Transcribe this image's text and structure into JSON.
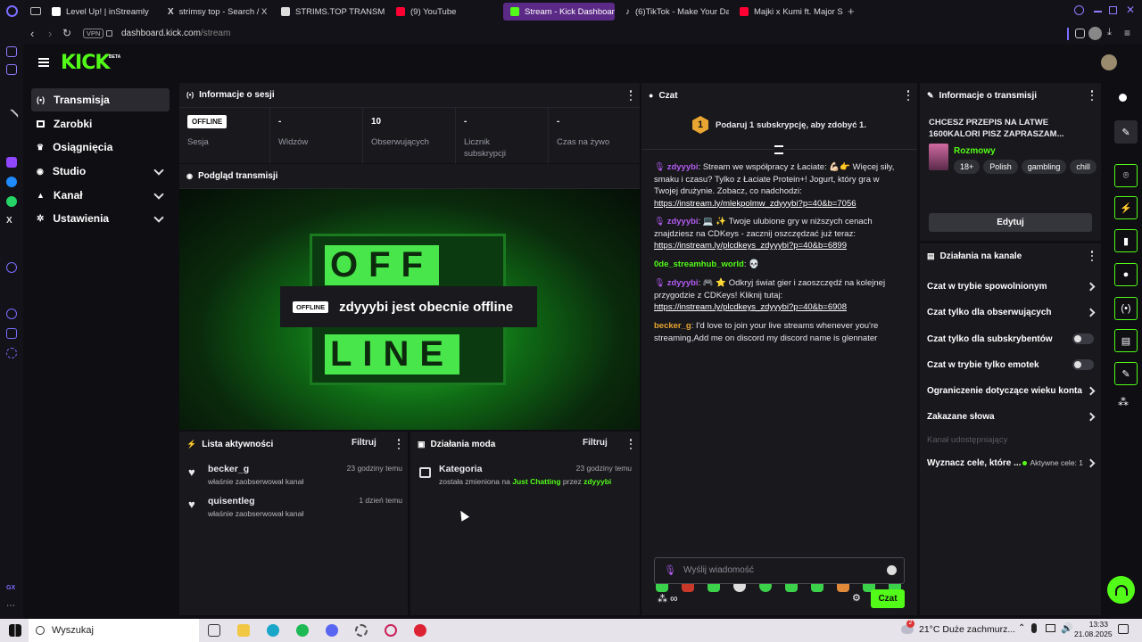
{
  "browser": {
    "tabs": [
      {
        "label": "Level Up! | inStreamly",
        "color": "#ffffff"
      },
      {
        "label": "strimsy top - Search / X",
        "color": "#cccccc"
      },
      {
        "label": "STRIMS.TOP TRANSM",
        "color": "#ffffff"
      },
      {
        "label": "(9) YouTube",
        "color": "#ff0033"
      },
      {
        "label": "Stream - Kick Dashboard",
        "color": "#53fc18"
      },
      {
        "label": "(6)TikTok - Make Your Da",
        "color": "#25f4ee"
      },
      {
        "label": "Majki x Kumi ft. Major SP",
        "color": "#ff0033"
      }
    ],
    "vpn": "VPN",
    "url_host": "dashboard.kick.com",
    "url_path": "/stream"
  },
  "kick": {
    "logo": "KICK",
    "beta": "BETA",
    "nav": [
      {
        "label": "Transmisja",
        "icon": "broadcast-icon"
      },
      {
        "label": "Zarobki",
        "icon": "wallet-icon"
      },
      {
        "label": "Osiągnięcia",
        "icon": "trophy-icon"
      },
      {
        "label": "Studio",
        "icon": "camera-icon"
      },
      {
        "label": "Kanał",
        "icon": "user-icon"
      },
      {
        "label": "Ustawienia",
        "icon": "gear-icon"
      }
    ],
    "session": {
      "title": "Informacje o sesji",
      "badge": "OFFLINE",
      "stats": [
        {
          "value": "",
          "label": "Sesja"
        },
        {
          "value": "-",
          "label": "Widzów"
        },
        {
          "value": "10",
          "label": "Obserwujących"
        },
        {
          "value": "-",
          "label": "Licznik subskrypcji"
        },
        {
          "value": "-",
          "label": "Czas na żywo"
        }
      ]
    },
    "preview": {
      "title": "Podgląd transmisji",
      "badge": "OFFLINE",
      "message": "zdyyybi jest obecnie offline",
      "sign_top": "OFF",
      "sign_bottom": "LINE"
    },
    "activity": {
      "title": "Lista aktywności",
      "filter": "Filtruj",
      "items": [
        {
          "name": "becker_g",
          "action": "właśnie zaobserwował kanał",
          "time": "23 godziny temu"
        },
        {
          "name": "quisentleg",
          "action": "właśnie zaobserwował kanał",
          "time": "1 dzień temu"
        }
      ]
    },
    "mod": {
      "title": "Działania moda",
      "filter": "Filtruj",
      "item": {
        "title": "Kategoria",
        "pre": "została zmieniona na",
        "category": "Just Chatting",
        "by": "przez",
        "user": "zdyyybi",
        "time": "23 godziny temu"
      }
    },
    "chat": {
      "title": "Czat",
      "promo_num": "1",
      "promo": "Podaruj 1 subskrypcję, aby zdobyć 1.",
      "messages": [
        {
          "user": "zdyyybi",
          "text": "Stream we współpracy z Łaciate: 💪🏻👉 Więcej siły, smaku i czasu? Tylko z Łaciate Protein+! Jogurt, który gra w Twojej drużynie. Zobacz, co nadchodzi:",
          "link": "https://instream.ly/mlekpolmw_zdyyybi?p=40&b=7056"
        },
        {
          "user": "zdyyybi",
          "text": "💻 ✨ Twoje ulubione gry w niższych cenach znajdziesz na CDKeys - zacznij oszczędzać już teraz:",
          "link": "https://instream.ly/plcdkeys_zdyyybi?p=40&b=6899"
        },
        {
          "user": "0de_streamhub_world",
          "text": "💀",
          "link": ""
        },
        {
          "user": "zdyyybi",
          "text": "🎮 ⭐ Odkryj świat gier i zaoszczędź na kolejnej przygodzie z CDKeys! Kliknij tutaj:",
          "link": "https://instream.ly/plcdkeys_zdyyybi?p=40&b=6908"
        },
        {
          "user": "becker_g",
          "text": "I'd love to join your live streams whenever you're streaming,Add me on discord my discord name is glennater",
          "link": ""
        }
      ],
      "placeholder": "Wyślij wiadomość",
      "send": "Czat"
    },
    "info": {
      "title": "Informacje o transmisji",
      "stream_title": "CHCESZ PRZEPIS NA LATWE 1600KALORI PISZ ZAPRASZAM...",
      "category": "Rozmowy",
      "tags": [
        "18+",
        "Polish",
        "gambling",
        "chill"
      ],
      "edit": "Edytuj"
    },
    "actions": {
      "title": "Działania na kanale",
      "rows": [
        {
          "label": "Czat w trybie spowolnionym",
          "type": "link"
        },
        {
          "label": "Czat tylko dla obserwujących",
          "type": "link"
        },
        {
          "label": "Czat tylko dla subskrybentów",
          "type": "toggle"
        },
        {
          "label": "Czat w trybie tylko emotek",
          "type": "toggle"
        },
        {
          "label": "Ograniczenie dotyczące wieku konta",
          "type": "link"
        },
        {
          "label": "Zakazane słowa",
          "type": "link"
        },
        {
          "label": "Kanał udostępniający",
          "type": "disabled"
        },
        {
          "label": "Wyznacz cele, które ...",
          "type": "link"
        }
      ],
      "goals": "Aktywne cele: 1"
    }
  },
  "taskbar": {
    "search": "Wyszukaj",
    "weather_badge": "2",
    "weather": "21°C  Duże zachmurz...",
    "time": "13:33",
    "date": "21.08.2025"
  },
  "colors": {
    "accent": "#53fc18",
    "purple": "#b35cf0",
    "bg": "#0e0e13",
    "panel": "#18181d"
  }
}
